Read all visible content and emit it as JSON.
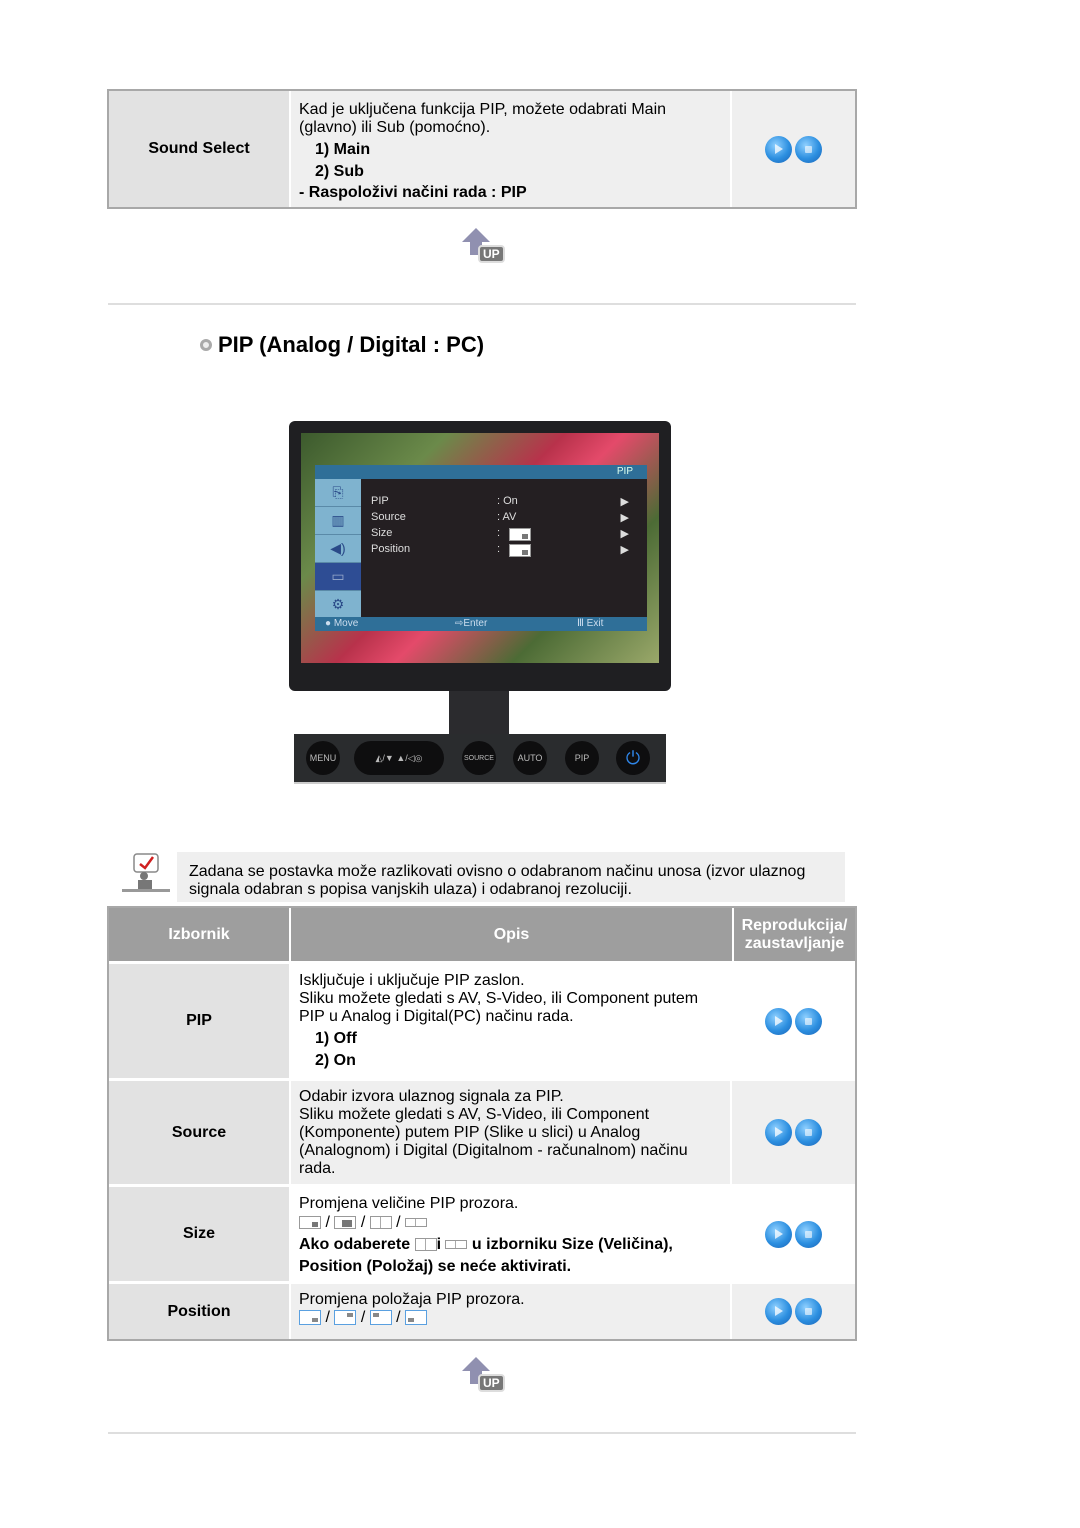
{
  "top_table": {
    "rows": [
      {
        "menu": "Sound Select",
        "desc_lines": [
          "Kad je uključena funkcija PIP, možete odabrati Main",
          "(glavno) ili Sub (pomoćno)."
        ],
        "options": [
          "1) Main",
          "2) Sub"
        ],
        "footer": "- Raspoloživi načini rada : PIP",
        "play_icon": "play-stop-icons"
      }
    ]
  },
  "up_link": {
    "label": "UP",
    "icon": "up-arrow-icon"
  },
  "section": {
    "title": "PIP (Analog / Digital : PC)",
    "bullet_icon": "circle-bullet-icon"
  },
  "monitor": {
    "osd_title": "PIP",
    "items": [
      {
        "label": "PIP",
        "value": ": On",
        "arrow": "▶"
      },
      {
        "label": "Source",
        "value": ": AV",
        "arrow": "▶"
      },
      {
        "label": "Size",
        "value": ":",
        "arrow": "▶"
      },
      {
        "label": "Position",
        "value": ":",
        "arrow": "▶"
      }
    ],
    "footer": {
      "move": "● Move",
      "enter": "⇨Enter",
      "exit": "Ⅲ Exit"
    },
    "buttons": [
      "MENU",
      "◭/▼     ▲/◁◎",
      "SOURCE",
      "AUTO",
      "PIP",
      "⏻"
    ]
  },
  "note": {
    "text_lines": [
      "Zadana se postavka može razlikovati ovisno o odabranom načinu unosa (izvor ulaznog",
      "signala odabran s popisa vanjskih ulaza) i odabranoj rezoluciji."
    ],
    "icon": "note-checkmark-icon"
  },
  "table": {
    "headers": [
      "Izbornik",
      "Opis",
      "Reprodukcija/ zaustavljanje"
    ],
    "rows": [
      {
        "menu": "PIP",
        "desc_lines": [
          "Isključuje i uključuje PIP zaslon.",
          "Sliku možete gledati s AV, S-Video, ili Component putem",
          "PIP u Analog i Digital(PC) načinu rada."
        ],
        "options": [
          "1) Off",
          "2) On"
        ]
      },
      {
        "menu": "Source",
        "desc_lines": [
          "Odabir izvora ulaznog signala za PIP.",
          "Sliku možete gledati s AV, S-Video, ili Component",
          "(Komponente) putem PIP (Slike u slici) u Analog",
          "(Analognom) i Digital (Digitalnom - računalnom) načinu",
          "rada."
        ]
      },
      {
        "menu": "Size",
        "desc_lines": [
          "Promjena veličine PIP prozora."
        ],
        "bold_line1_a": "Ako odaberete ",
        "bold_line1_b": "i ",
        "bold_line1_c": " u izborniku Size (Veličina),",
        "bold_line2": "Position (Položaj) se neće aktivirati.",
        "separator": "/"
      },
      {
        "menu": "Position",
        "desc_lines": [
          "Promjena položaja PIP prozora."
        ],
        "separator": "/"
      }
    ]
  }
}
